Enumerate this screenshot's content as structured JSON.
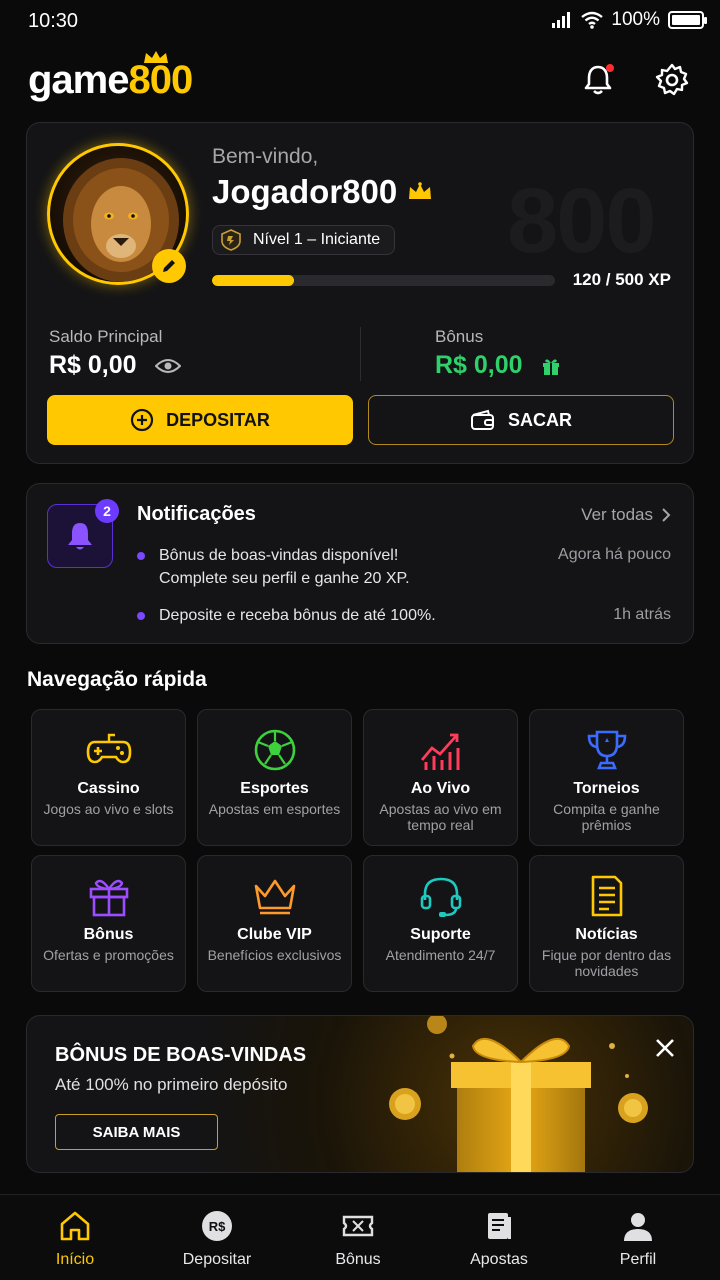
{
  "status_bar": {
    "time": "10:30",
    "battery": "100%"
  },
  "header": {
    "logo_text_1": "game",
    "logo_text_2": "800",
    "icons": [
      "bell-icon",
      "gear-icon"
    ],
    "has_unread": true
  },
  "profile": {
    "welcome": "Bem-vindo,",
    "username": "Jogador800",
    "level": "Nível 1 – Iniciante",
    "xp_text": "120 / 500 XP",
    "xp_progress": 0.24,
    "watermark": "800",
    "balance_label": "Saldo Principal",
    "balance_value": "R$ 0,00",
    "bonus_label": "Bônus",
    "bonus_value": "R$ 0,00",
    "deposit_label": "DEPOSITAR",
    "withdraw_label": "SACAR"
  },
  "notifications": {
    "title": "Notificações",
    "badge": "2",
    "see_all": "Ver todas",
    "items": [
      {
        "line1": "Bônus de boas-vindas disponível!",
        "line2": "Complete seu perfil e ganhe 20 XP.",
        "time": "Agora há pouco"
      },
      {
        "line1": "Deposite e receba bônus de até 100%.",
        "time": "1h atrás"
      }
    ]
  },
  "quick_nav": {
    "title": "Navegação rápida",
    "tiles": [
      {
        "title": "Cassino",
        "sub": "Jogos ao vivo e slots",
        "icon": "gamepad-icon",
        "color": "#ffc800"
      },
      {
        "title": "Esportes",
        "sub": "Apostas em esportes",
        "icon": "soccer-ball-icon",
        "color": "#3ed13e"
      },
      {
        "title": "Ao Vivo",
        "sub": "Apostas ao vivo em tempo real",
        "icon": "live-chart-icon",
        "color": "#ff3d5a"
      },
      {
        "title": "Torneios",
        "sub": "Compita e ganhe prêmios",
        "icon": "trophy-icon",
        "color": "#3b6bff"
      },
      {
        "title": "Bônus",
        "sub": "Ofertas e promoções",
        "icon": "gift-icon",
        "color": "#9b4dff"
      },
      {
        "title": "Clube VIP",
        "sub": "Benefícios exclusivos",
        "icon": "crown-icon",
        "color": "#ff9a2a"
      },
      {
        "title": "Suporte",
        "sub": "Atendimento 24/7",
        "icon": "headset-icon",
        "color": "#1ec9c0"
      },
      {
        "title": "Notícias",
        "sub": "Fique por dentro das novidades",
        "icon": "news-icon",
        "color": "#ffc800"
      }
    ]
  },
  "promo": {
    "title": "BÔNUS DE BOAS-VINDAS",
    "subtitle": "Até 100% no primeiro depósito",
    "button": "SAIBA MAIS"
  },
  "bottom_nav": [
    {
      "label": "Início",
      "icon": "home-icon",
      "active": true
    },
    {
      "label": "Depositar",
      "icon": "deposit-coin-icon"
    },
    {
      "label": "Bônus",
      "icon": "ticket-icon"
    },
    {
      "label": "Apostas",
      "icon": "bets-icon"
    },
    {
      "label": "Perfil",
      "icon": "profile-icon"
    }
  ],
  "colors": {
    "accent": "#ffc800",
    "bonus_green": "#2fd16a",
    "notif_purple": "#6d3bff",
    "background": "#0a0a0b"
  }
}
